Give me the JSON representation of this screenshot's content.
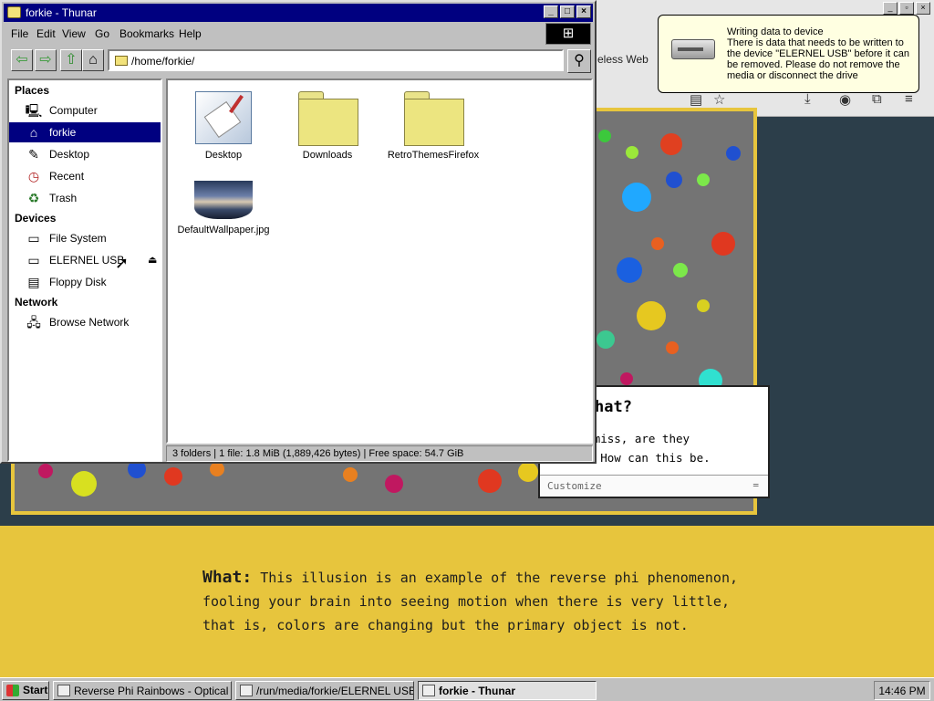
{
  "browser": {
    "tab_partial": "eless Web",
    "demo_partial_title": "hat?",
    "demo_partial_body_line1": "ng is amiss, are they",
    "demo_partial_body_line2": "or not? How can this be.",
    "customize_label": "Customize",
    "customize_grip": "=",
    "bottom_heading": "What:",
    "bottom_text": "This illusion is an example of the reverse phi phenomenon, fooling your brain into seeing motion when there is very little, that is, colors are changing but the primary object is not."
  },
  "notification": {
    "title": "Writing data to device",
    "message": "There is data that needs to be written to the device \"ELERNEL USB\" before it can be removed. Please do not remove the media or disconnect the drive"
  },
  "thunar": {
    "title": "forkie - Thunar",
    "menu": [
      "File",
      "Edit",
      "View",
      "Go",
      "Bookmarks",
      "Help"
    ],
    "address": "/home/forkie/",
    "sidebar": {
      "places_heading": "Places",
      "places": [
        "Computer",
        "forkie",
        "Desktop",
        "Recent",
        "Trash"
      ],
      "devices_heading": "Devices",
      "devices": [
        "File System",
        "ELERNEL USB",
        "Floppy Disk"
      ],
      "network_heading": "Network",
      "network": [
        "Browse Network"
      ]
    },
    "files": [
      {
        "name": "Desktop",
        "kind": "desktop-folder"
      },
      {
        "name": "Downloads",
        "kind": "folder"
      },
      {
        "name": "RetroThemesFirefox",
        "kind": "folder"
      },
      {
        "name": "DefaultWallpaper.jpg",
        "kind": "image"
      }
    ],
    "status": "3 folders  |  1 file: 1.8 MiB (1,889,426 bytes)  |  Free space: 54.7 GiB"
  },
  "taskbar": {
    "start_label": "Start",
    "tasks": [
      {
        "label": "Reverse Phi Rainbows - Optical Il...",
        "active": false
      },
      {
        "label": "/run/media/forkie/ELERNEL USB/...",
        "active": false
      },
      {
        "label": "forkie - Thunar",
        "active": true
      }
    ],
    "clock": "14:46 PM"
  },
  "colors": {
    "title_bar": "#000080",
    "chrome": "#c0c0c0",
    "demo_yellow": "#e7c53d",
    "demo_gray": "#747474"
  }
}
